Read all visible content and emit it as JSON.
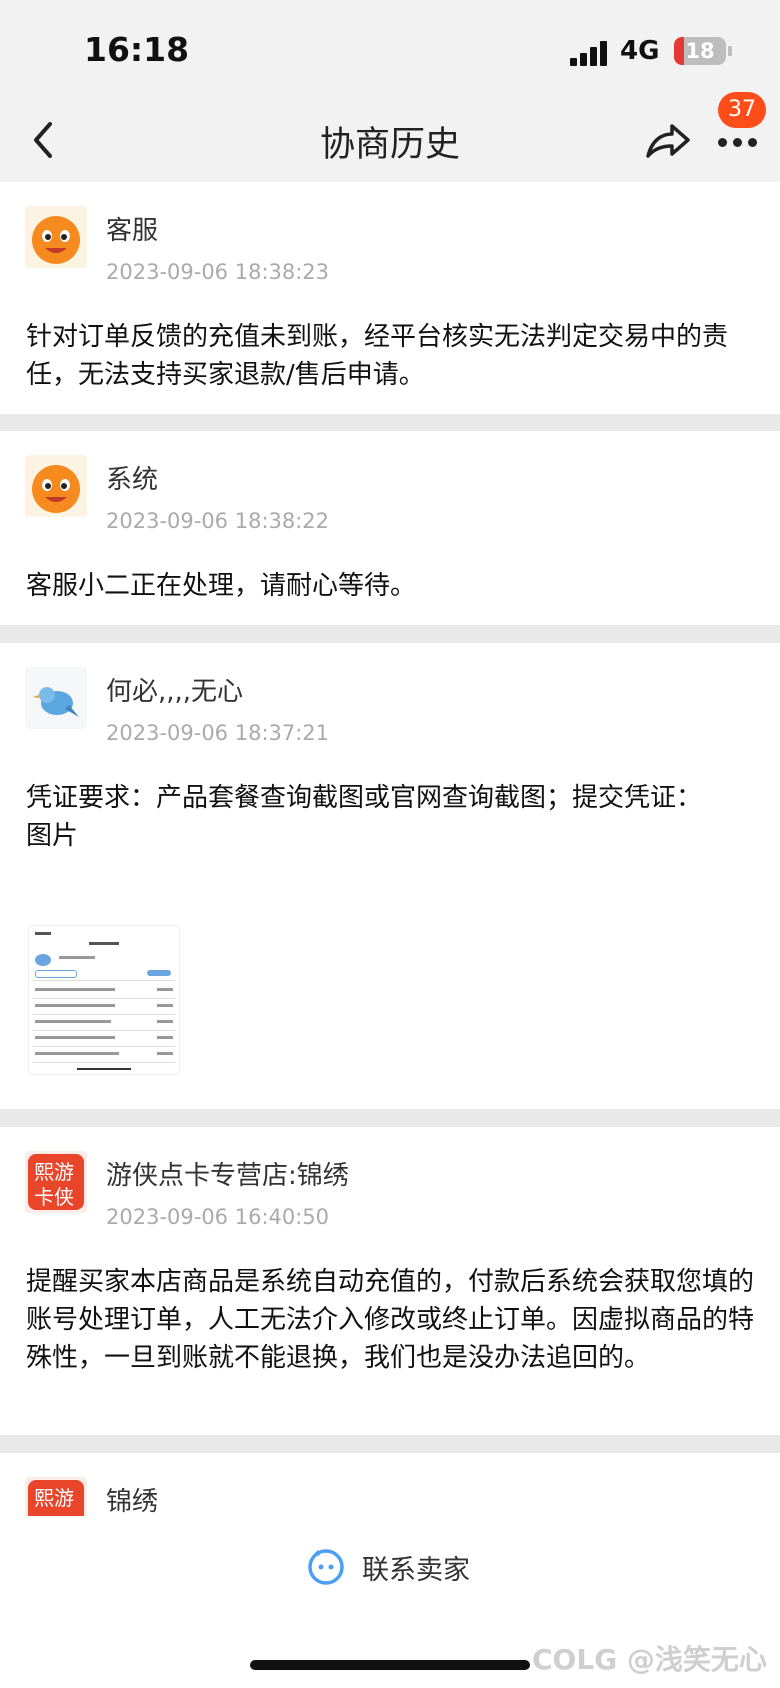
{
  "status": {
    "time": "16:18",
    "network": "4G",
    "battery": "18"
  },
  "nav": {
    "title": "协商历史",
    "badge": "37"
  },
  "messages": [
    {
      "sender": "客服",
      "time": "2023-09-06 18:38:23",
      "text": "针对订单反馈的充值未到账，经平台核实无法判定交易中的责任，无法支持买家退款/售后申请。",
      "avatar": "orange-mascot"
    },
    {
      "sender": "系统",
      "time": "2023-09-06 18:38:22",
      "text": "客服小二正在处理，请耐心等待。",
      "avatar": "orange-mascot"
    },
    {
      "sender": "何必,,,,无心",
      "time": "2023-09-06 18:37:21",
      "text": "凭证要求：产品套餐查询截图或官网查询截图；提交凭证：\n图片",
      "avatar": "blue-bird"
    },
    {
      "sender": "游侠点卡专营店:锦绣",
      "time": "2023-09-06 16:40:50",
      "text": "提醒买家本店商品是系统自动充值的，付款后系统会获取您填的账号处理订单，人工无法介入修改或终止订单。因虚拟商品的特殊性，一旦到账就不能退换，我们也是没办法追回的。",
      "avatar": "shop-logo",
      "logo_text": "熙游卡侠"
    },
    {
      "sender": "锦绣",
      "avatar": "shop-logo",
      "logo_text": "熙游"
    }
  ],
  "bottom": {
    "contact_label": "联系卖家",
    "watermark": "COLG @浅笑无心"
  },
  "colors": {
    "badge": "#ff4d1a",
    "battery_low": "#e53935",
    "mascot": "#f58a1f",
    "contact_icon": "#4a9ff5"
  }
}
